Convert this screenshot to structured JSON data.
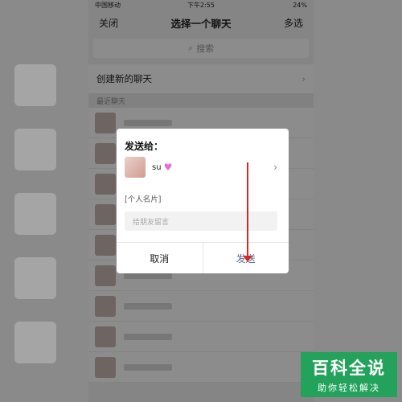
{
  "status_bar": {
    "carrier": "中国移动",
    "time": "下午2:55",
    "battery": "24%"
  },
  "nav": {
    "close_label": "关闭",
    "title": "选择一个聊天",
    "multiselect_label": "多选"
  },
  "search": {
    "placeholder": "搜索"
  },
  "list": {
    "create_new_chat": "创建新的聊天",
    "recent_header": "最近聊天"
  },
  "dialog": {
    "title": "发送给：",
    "recipient_name": "su",
    "card_label": "[个人名片]",
    "message_placeholder": "给朋友留言",
    "cancel_label": "取消",
    "send_label": "发送"
  },
  "watermark": {
    "main": "百科全说",
    "sub": "助你轻松解决"
  },
  "colors": {
    "accent_send": "#576b95",
    "arrow": "#d02b2b",
    "watermark_bg": "#22a25a"
  }
}
